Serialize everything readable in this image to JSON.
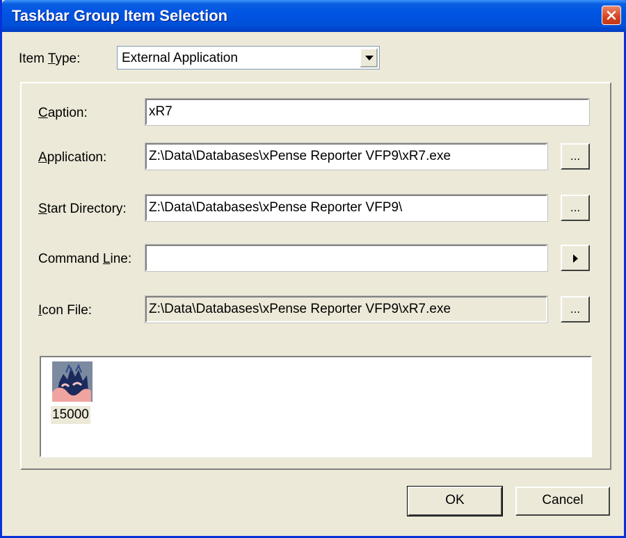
{
  "window": {
    "title": "Taskbar Group Item Selection"
  },
  "item_type": {
    "label_pre": "Item ",
    "label_accel": "T",
    "label_post": "ype:",
    "value": "External Application"
  },
  "fields": {
    "caption": {
      "label_accel": "C",
      "label_rest": "aption:",
      "value": "xR7"
    },
    "application": {
      "label_accel": "A",
      "label_rest": "pplication:",
      "value": "Z:\\Data\\Databases\\xPense Reporter VFP9\\xR7.exe",
      "browse": "..."
    },
    "start_directory": {
      "label_accel": "S",
      "label_rest": "tart Directory:",
      "value": "Z:\\Data\\Databases\\xPense Reporter VFP9\\",
      "browse": "..."
    },
    "command_line": {
      "label_pre": "Command ",
      "label_accel": "L",
      "label_post": "ine:",
      "value": ""
    },
    "icon_file": {
      "label_accel": "I",
      "label_rest": "con File:",
      "value": "Z:\\Data\\Databases\\xPense Reporter VFP9\\xR7.exe",
      "browse": "..."
    }
  },
  "icon_list": {
    "items": [
      {
        "caption": "15000",
        "icon": "xr7-app-icon"
      }
    ]
  },
  "buttons": {
    "ok": "OK",
    "cancel": "Cancel"
  },
  "colors": {
    "titlebar": "#0054e3",
    "dialog_bg": "#ece9d8",
    "close_button": "#d7431f"
  }
}
